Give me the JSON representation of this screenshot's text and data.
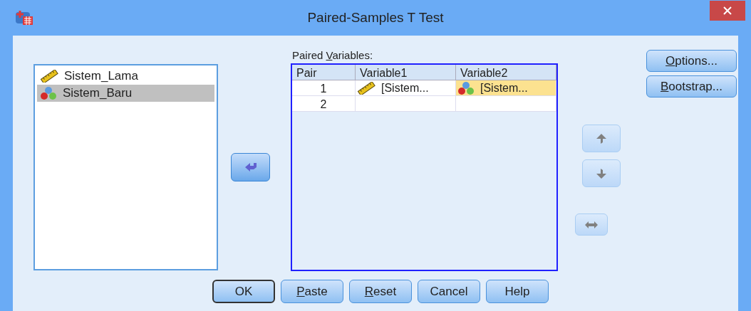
{
  "window": {
    "title": "Paired-Samples T Test"
  },
  "variables": [
    {
      "name": "Sistem_Lama",
      "kind": "scale",
      "selected": false
    },
    {
      "name": "Sistem_Baru",
      "kind": "nominal",
      "selected": true
    }
  ],
  "paired_variables": {
    "label_parts": [
      {
        "text": "Paired ",
        "underlined": false
      },
      {
        "text": "V",
        "underlined": true
      },
      {
        "text": "ariables:",
        "underlined": false
      }
    ],
    "columns": [
      "Pair",
      "Variable1",
      "Variable2"
    ],
    "rows": [
      {
        "pair": "1",
        "cells": [
          {
            "text": "[Sistem...",
            "kind": "scale",
            "selected": false
          },
          {
            "text": "[Sistem...",
            "kind": "nominal",
            "selected": true
          }
        ]
      },
      {
        "pair": "2",
        "cells": [
          {
            "kind": "empty",
            "selected": false
          },
          {
            "kind": "empty",
            "selected": false
          }
        ]
      }
    ]
  },
  "side_buttons": [
    {
      "label_parts": [
        {
          "text": "O",
          "underlined": true
        },
        {
          "text": "ptions...",
          "underlined": false
        }
      ]
    },
    {
      "label_parts": [
        {
          "text": "B",
          "underlined": true
        },
        {
          "text": "ootstrap...",
          "underlined": false
        }
      ]
    }
  ],
  "reorder_buttons": [
    {
      "kind": "up",
      "disabled": true
    },
    {
      "kind": "down",
      "disabled": true
    },
    {
      "kind": "swap",
      "disabled": true
    }
  ],
  "move_button": {
    "kind": "left",
    "disabled": false
  },
  "buttons": [
    {
      "label_parts": [
        {
          "text": "OK",
          "underlined": false
        }
      ],
      "default": true
    },
    {
      "label_parts": [
        {
          "text": "P",
          "underlined": true
        },
        {
          "text": "aste",
          "underlined": false
        }
      ],
      "default": false
    },
    {
      "label_parts": [
        {
          "text": "R",
          "underlined": true
        },
        {
          "text": "eset",
          "underlined": false
        }
      ],
      "default": false
    },
    {
      "label_parts": [
        {
          "text": "Cancel",
          "underlined": false
        }
      ],
      "default": false
    },
    {
      "label_parts": [
        {
          "text": "Help",
          "underlined": false
        }
      ],
      "default": false
    }
  ]
}
